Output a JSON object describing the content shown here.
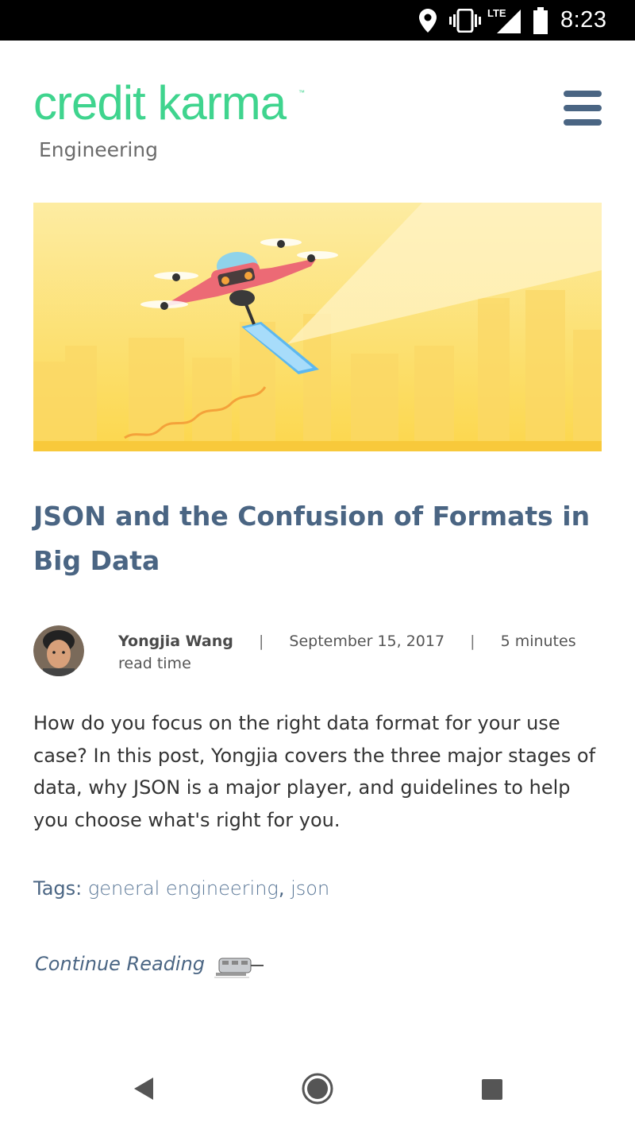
{
  "status_bar": {
    "time": "8:23",
    "network": "LTE",
    "icons": [
      "location-icon",
      "vibrate-icon",
      "signal-icon",
      "battery-icon"
    ]
  },
  "header": {
    "logo_text": "credit karma",
    "logo_tm": "™",
    "subtitle": "Engineering",
    "menu_icon": "hamburger-menu-icon"
  },
  "post": {
    "title": "JSON and the Confusion of Formats in Big Data",
    "author": "Yongjia Wang",
    "separator": "|",
    "date": "September 15, 2017",
    "read_time": "5 minutes read time",
    "excerpt": "How do you focus on the right data format for your use case? In this post, Yongjia covers the three major stages of data, why JSON is a major player, and guidelines to help you choose what's right for you.",
    "tags_label": "Tags:",
    "tags": [
      "general engineering",
      "json"
    ],
    "tag_separator": ",",
    "continue_label": "Continue Reading"
  },
  "colors": {
    "brand_green": "#3fd48e",
    "title_blue": "#4a6583",
    "hero_yellow": "#fde37a"
  },
  "nav_bar": {
    "icons": [
      "back-icon",
      "home-icon",
      "recents-icon"
    ]
  }
}
